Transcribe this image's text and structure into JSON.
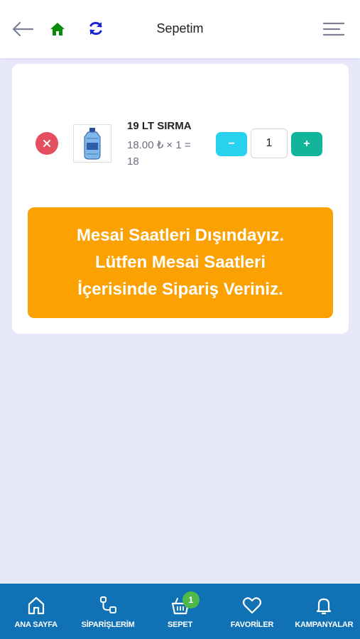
{
  "header": {
    "title": "Sepetim",
    "icons": {
      "back": "back-arrow-icon",
      "home": "home-icon",
      "refresh": "refresh-icon",
      "menu": "hamburger-menu-icon"
    },
    "colors": {
      "home": "#0a8a0a",
      "refresh": "#1a24d8"
    }
  },
  "cart": {
    "items": [
      {
        "name": "19 LT SIRMA",
        "price_line": "18.00 ₺ × 1 = 18",
        "quantity": "1",
        "image": "water-bottle-icon"
      }
    ],
    "notice": "Mesai Saatleri Dışındayız. Lütfen Mesai Saatleri İçerisinde Sipariş Veriniz.",
    "minus_label": "−",
    "plus_label": "+"
  },
  "bottom_nav": {
    "items": [
      {
        "label": "ANA SAYFA",
        "icon": "home-icon"
      },
      {
        "label": "SİPARİŞLERİM",
        "icon": "orders-icon"
      },
      {
        "label": "SEPET",
        "icon": "basket-icon",
        "badge": "1"
      },
      {
        "label": "FAVORİLER",
        "icon": "heart-icon"
      },
      {
        "label": "KAMPANYALAR",
        "icon": "bell-icon"
      }
    ]
  },
  "colors": {
    "background": "#e8e8fb",
    "nav": "#1072b4",
    "notice": "#fba202",
    "remove": "#e44f5f",
    "minus": "#29d1ee",
    "plus": "#13b59a",
    "badge": "#4eb848"
  }
}
